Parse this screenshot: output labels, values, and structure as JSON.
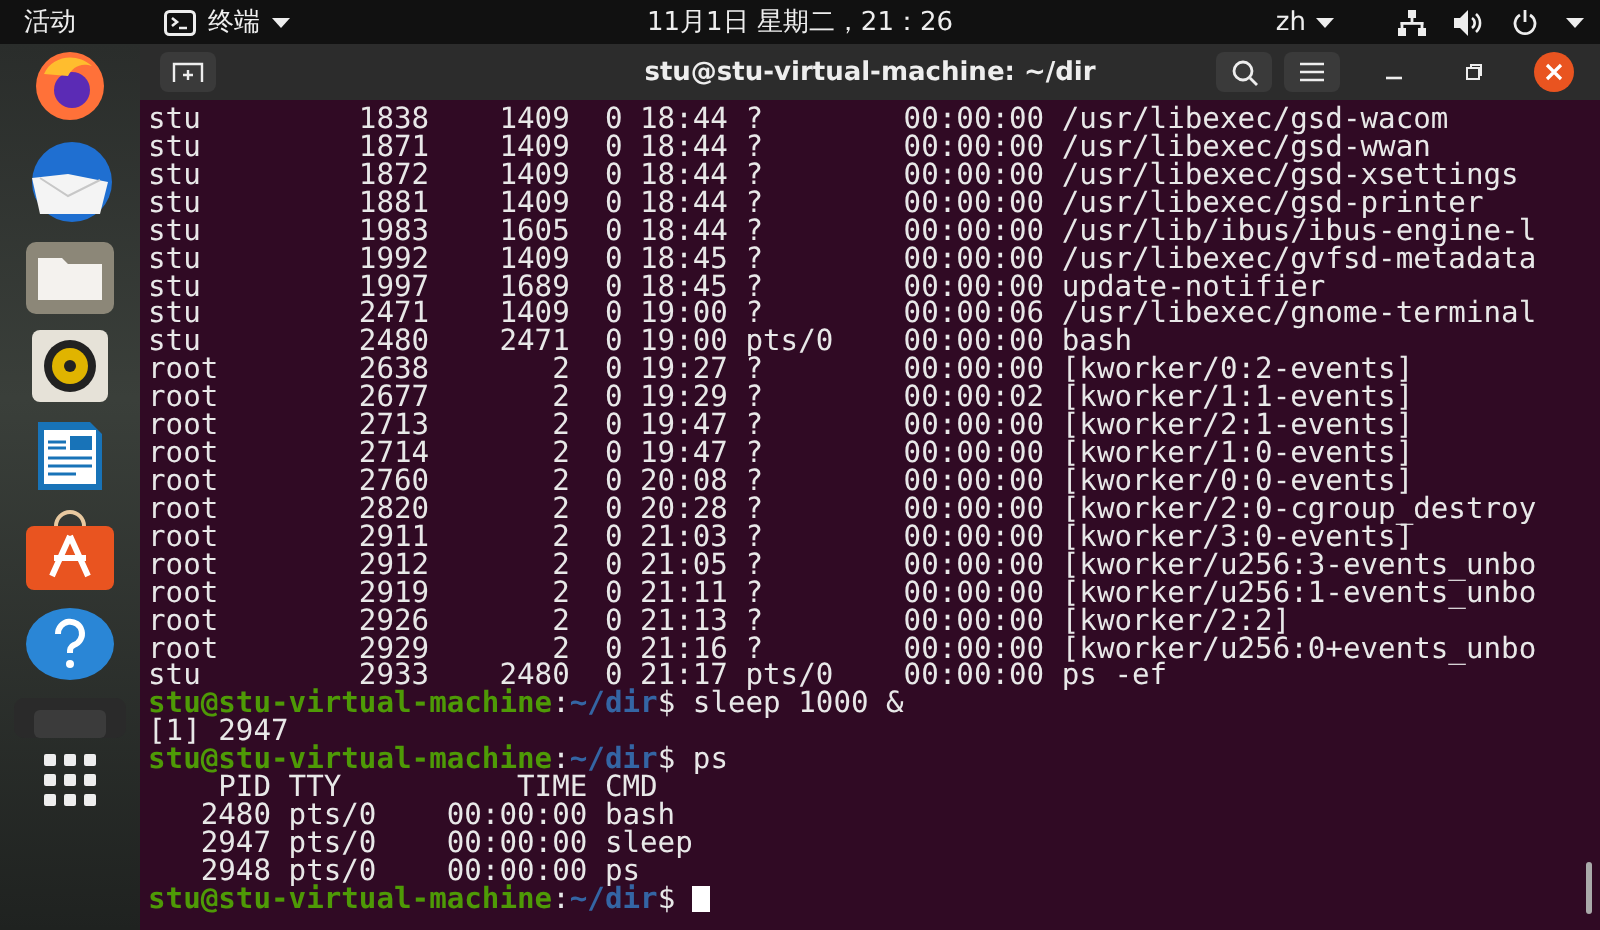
{
  "top_bar": {
    "activities": "活动",
    "app_menu": "终端",
    "clock": "11月1日 星期二，21：26",
    "input_method": "zh"
  },
  "window": {
    "title": "stu@stu-virtual-machine: ~/dir"
  },
  "terminal": {
    "lines": [
      {
        "kind": "output",
        "text": "stu         1838    1409  0 18:44 ?        00:00:00 /usr/libexec/gsd-wacom"
      },
      {
        "kind": "output",
        "text": "stu         1871    1409  0 18:44 ?        00:00:00 /usr/libexec/gsd-wwan"
      },
      {
        "kind": "output",
        "text": "stu         1872    1409  0 18:44 ?        00:00:00 /usr/libexec/gsd-xsettings"
      },
      {
        "kind": "output",
        "text": "stu         1881    1409  0 18:44 ?        00:00:00 /usr/libexec/gsd-printer"
      },
      {
        "kind": "output",
        "text": "stu         1983    1605  0 18:44 ?        00:00:00 /usr/lib/ibus/ibus-engine-l"
      },
      {
        "kind": "output",
        "text": "stu         1992    1409  0 18:45 ?        00:00:00 /usr/libexec/gvfsd-metadata"
      },
      {
        "kind": "output",
        "text": "stu         1997    1689  0 18:45 ?        00:00:00 update-notifier"
      },
      {
        "kind": "output",
        "text": "stu         2471    1409  0 19:00 ?        00:00:06 /usr/libexec/gnome-terminal"
      },
      {
        "kind": "output",
        "text": "stu         2480    2471  0 19:00 pts/0    00:00:00 bash"
      },
      {
        "kind": "output",
        "text": "root        2638       2  0 19:27 ?        00:00:00 [kworker/0:2-events]"
      },
      {
        "kind": "output",
        "text": "root        2677       2  0 19:29 ?        00:00:02 [kworker/1:1-events]"
      },
      {
        "kind": "output",
        "text": "root        2713       2  0 19:47 ?        00:00:00 [kworker/2:1-events]"
      },
      {
        "kind": "output",
        "text": "root        2714       2  0 19:47 ?        00:00:00 [kworker/1:0-events]"
      },
      {
        "kind": "output",
        "text": "root        2760       2  0 20:08 ?        00:00:00 [kworker/0:0-events]"
      },
      {
        "kind": "output",
        "text": "root        2820       2  0 20:28 ?        00:00:00 [kworker/2:0-cgroup_destroy"
      },
      {
        "kind": "output",
        "text": "root        2911       2  0 21:03 ?        00:00:00 [kworker/3:0-events]"
      },
      {
        "kind": "output",
        "text": "root        2912       2  0 21:05 ?        00:00:00 [kworker/u256:3-events_unbo"
      },
      {
        "kind": "output",
        "text": "root        2919       2  0 21:11 ?        00:00:00 [kworker/u256:1-events_unbo"
      },
      {
        "kind": "output",
        "text": "root        2926       2  0 21:13 ?        00:00:00 [kworker/2:2]"
      },
      {
        "kind": "output",
        "text": "root        2929       2  0 21:16 ?        00:00:00 [kworker/u256:0+events_unbo"
      },
      {
        "kind": "output",
        "text": "stu         2933    2480  0 21:17 pts/0    00:00:00 ps -ef"
      },
      {
        "kind": "prompt",
        "user": "stu@stu-virtual-machine",
        "colon": ":",
        "path": "~/dir",
        "symbol": "$",
        "command": " sleep 1000 &",
        "cursor": false
      },
      {
        "kind": "output",
        "text": "[1] 2947"
      },
      {
        "kind": "prompt",
        "user": "stu@stu-virtual-machine",
        "colon": ":",
        "path": "~/dir",
        "symbol": "$",
        "command": " ps",
        "cursor": false
      },
      {
        "kind": "output",
        "text": "    PID TTY          TIME CMD"
      },
      {
        "kind": "output",
        "text": "   2480 pts/0    00:00:00 bash"
      },
      {
        "kind": "output",
        "text": "   2947 pts/0    00:00:00 sleep"
      },
      {
        "kind": "output",
        "text": "   2948 pts/0    00:00:00 ps"
      },
      {
        "kind": "prompt",
        "user": "stu@stu-virtual-machine",
        "colon": ":",
        "path": "~/dir",
        "symbol": "$",
        "cursor": true
      }
    ]
  }
}
